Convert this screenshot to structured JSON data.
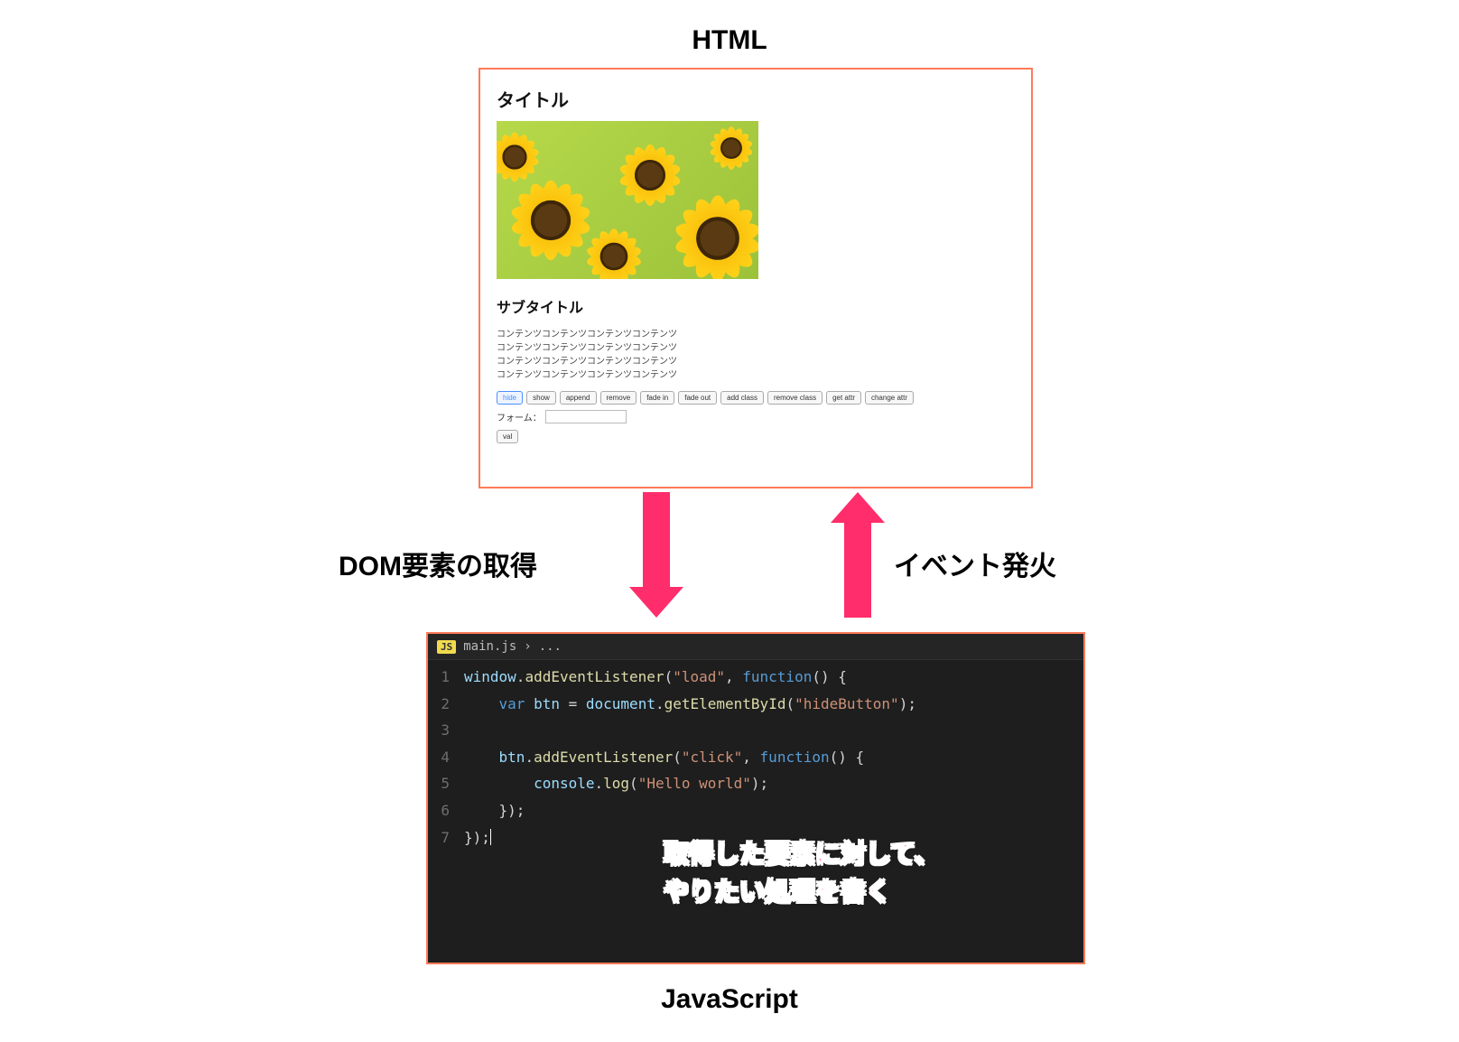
{
  "labels": {
    "top": "HTML",
    "bottom": "JavaScript",
    "left": "DOM要素の取得",
    "right": "イベント発火"
  },
  "html_panel": {
    "title": "タイトル",
    "subtitle": "サブタイトル",
    "content_lines": [
      "コンテンツコンテンツコンテンツコンテンツ",
      "コンテンツコンテンツコンテンツコンテンツ",
      "コンテンツコンテンツコンテンツコンテンツ",
      "コンテンツコンテンツコンテンツコンテンツ"
    ],
    "buttons": [
      "hide",
      "show",
      "append",
      "remove",
      "fade in",
      "fade out",
      "add class",
      "remove class",
      "get attr",
      "change attr"
    ],
    "active_button_index": 0,
    "form_label": "フォーム：",
    "form_value": "",
    "val_button": "val"
  },
  "code_panel": {
    "tab_file": "main.js",
    "tab_crumb": "...",
    "lines": [
      {
        "n": 1,
        "tokens": [
          {
            "t": "obj",
            "v": "window"
          },
          {
            "t": "pln",
            "v": "."
          },
          {
            "t": "mth",
            "v": "addEventListener"
          },
          {
            "t": "pln",
            "v": "("
          },
          {
            "t": "str",
            "v": "\"load\""
          },
          {
            "t": "pln",
            "v": ", "
          },
          {
            "t": "kw",
            "v": "function"
          },
          {
            "t": "pln",
            "v": "() {"
          }
        ]
      },
      {
        "n": 2,
        "indent": 1,
        "tokens": [
          {
            "t": "kw",
            "v": "var"
          },
          {
            "t": "pln",
            "v": " "
          },
          {
            "t": "obj",
            "v": "btn"
          },
          {
            "t": "pln",
            "v": " = "
          },
          {
            "t": "obj",
            "v": "document"
          },
          {
            "t": "pln",
            "v": "."
          },
          {
            "t": "mth",
            "v": "getElementById"
          },
          {
            "t": "pln",
            "v": "("
          },
          {
            "t": "str",
            "v": "\"hideButton\""
          },
          {
            "t": "pln",
            "v": ");"
          }
        ]
      },
      {
        "n": 3,
        "tokens": []
      },
      {
        "n": 4,
        "indent": 1,
        "tokens": [
          {
            "t": "obj",
            "v": "btn"
          },
          {
            "t": "pln",
            "v": "."
          },
          {
            "t": "mth",
            "v": "addEventListener"
          },
          {
            "t": "pln",
            "v": "("
          },
          {
            "t": "str",
            "v": "\"click\""
          },
          {
            "t": "pln",
            "v": ", "
          },
          {
            "t": "kw",
            "v": "function"
          },
          {
            "t": "pln",
            "v": "() {"
          }
        ]
      },
      {
        "n": 5,
        "indent": 2,
        "tokens": [
          {
            "t": "obj",
            "v": "console"
          },
          {
            "t": "pln",
            "v": "."
          },
          {
            "t": "mth",
            "v": "log"
          },
          {
            "t": "pln",
            "v": "("
          },
          {
            "t": "str",
            "v": "\"Hello world\""
          },
          {
            "t": "pln",
            "v": ");"
          }
        ]
      },
      {
        "n": 6,
        "indent": 1,
        "tokens": [
          {
            "t": "pln",
            "v": "});"
          }
        ]
      },
      {
        "n": 7,
        "tokens": [
          {
            "t": "pln",
            "v": "});"
          }
        ],
        "cursor_after": true
      }
    ]
  },
  "overlay": {
    "line1": "取得した要素に対して、",
    "line2": "やりたい処理を書く"
  }
}
